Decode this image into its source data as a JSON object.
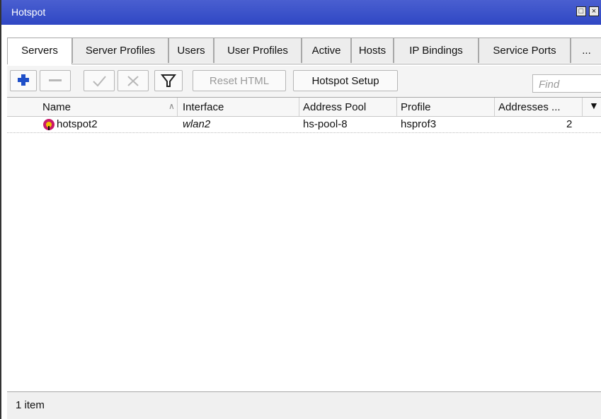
{
  "window": {
    "title": "Hotspot",
    "restore_symbol": "□",
    "close_symbol": "×"
  },
  "tabs": [
    {
      "label": "Servers",
      "active": true
    },
    {
      "label": "Server Profiles"
    },
    {
      "label": "Users"
    },
    {
      "label": "User Profiles"
    },
    {
      "label": "Active"
    },
    {
      "label": "Hosts"
    },
    {
      "label": "IP Bindings"
    },
    {
      "label": "Service Ports"
    },
    {
      "label": "..."
    }
  ],
  "toolbar": {
    "add_icon": "plus-icon",
    "remove_icon": "minus-icon",
    "enable_icon": "check-icon",
    "disable_icon": "x-icon",
    "filter_icon": "filter-icon",
    "reset_html_label": "Reset HTML",
    "hotspot_setup_label": "Hotspot Setup",
    "find_placeholder": "Find"
  },
  "table": {
    "columns": [
      "Name",
      "Interface",
      "Address Pool",
      "Profile",
      "Addresses ..."
    ],
    "rows": [
      {
        "name": "hotspot2",
        "interface": "wlan2",
        "address_pool": "hs-pool-8",
        "profile": "hsprof3",
        "addresses": "2"
      }
    ]
  },
  "status": {
    "text": "1 item"
  },
  "colors": {
    "titlebar": "#3a50c8",
    "add_icon": "#1f4fc8",
    "status_icon": "#c81a6a"
  }
}
